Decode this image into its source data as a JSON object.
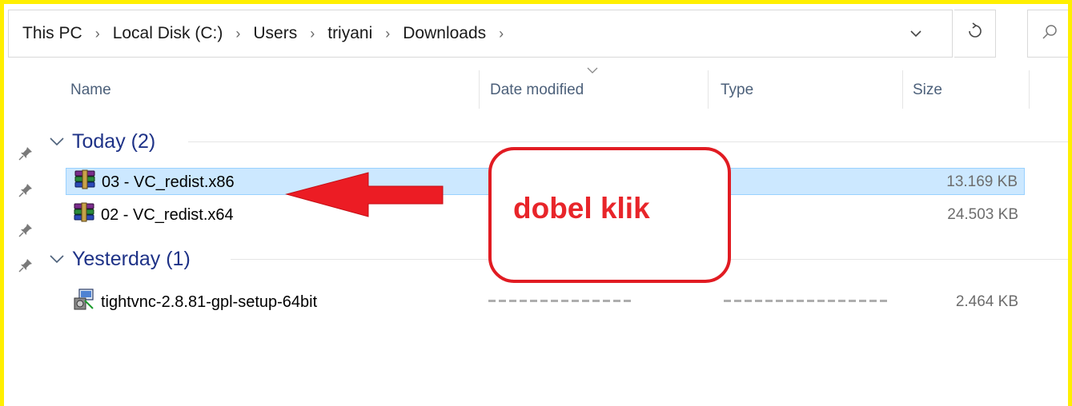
{
  "breadcrumb": [
    "This PC",
    "Local Disk (C:)",
    "Users",
    "triyani",
    "Downloads"
  ],
  "breadcrumb_separator": "›",
  "address_dropdown_icon": "chevron-down-icon",
  "refresh_icon": "refresh-icon",
  "search_icon": "search-icon",
  "columns": {
    "name": "Name",
    "date_modified": "Date modified",
    "type": "Type",
    "size": "Size"
  },
  "groups": [
    {
      "label": "Today (2)",
      "files": [
        {
          "name": "03 - VC_redist.x86",
          "size": "13.169 KB",
          "selected": true,
          "icon": "winrar-archive-icon"
        },
        {
          "name": "02 - VC_redist.x64",
          "size": "24.503 KB",
          "selected": false,
          "icon": "winrar-archive-icon"
        }
      ]
    },
    {
      "label": "Yesterday (1)",
      "files": [
        {
          "name": "tightvnc-2.8.81-gpl-setup-64bit",
          "size": "2.464 KB",
          "selected": false,
          "icon": "installer-icon"
        }
      ]
    }
  ],
  "annotation": {
    "text": "dobel klik",
    "color": "#e8252a"
  },
  "colors": {
    "frame": "#ffef00",
    "selection": "#cce8ff",
    "group_text": "#1e3287"
  }
}
